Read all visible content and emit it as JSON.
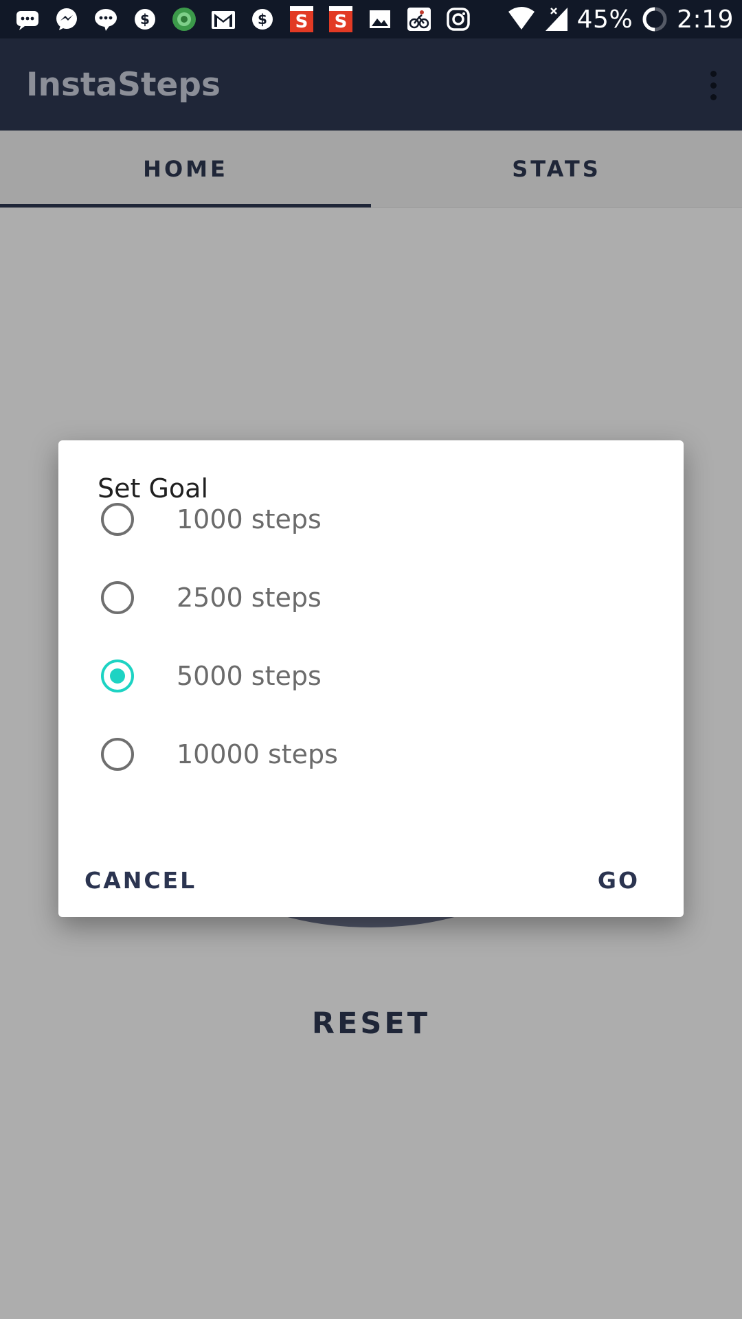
{
  "status_bar": {
    "notification_icons": [
      "message-icon",
      "messenger-icon",
      "chat-icon",
      "dollar-icon",
      "quran-app-icon",
      "gmail-icon",
      "dollar-icon",
      "sony-liv-icon",
      "sony-liv-icon",
      "image-icon",
      "cycling-icon",
      "instagram-icon"
    ],
    "battery_percent": "45%",
    "time": "2:19"
  },
  "app_bar": {
    "title": "InstaSteps",
    "menu_icon": "more-vert-icon"
  },
  "tabs": [
    {
      "label": "HOME",
      "active": true
    },
    {
      "label": "STATS",
      "active": false
    }
  ],
  "main": {
    "reset_label": "RESET"
  },
  "dialog": {
    "title": "Set Goal",
    "options": [
      {
        "label": "1000 steps",
        "selected": false
      },
      {
        "label": "2500 steps",
        "selected": false
      },
      {
        "label": "5000 steps",
        "selected": true
      },
      {
        "label": "10000 steps",
        "selected": false
      }
    ],
    "cancel_label": "CANCEL",
    "go_label": "GO"
  },
  "colors": {
    "app_bar": "#1f2638",
    "accent": "#1dd3c3",
    "scrim": "#adadad"
  }
}
